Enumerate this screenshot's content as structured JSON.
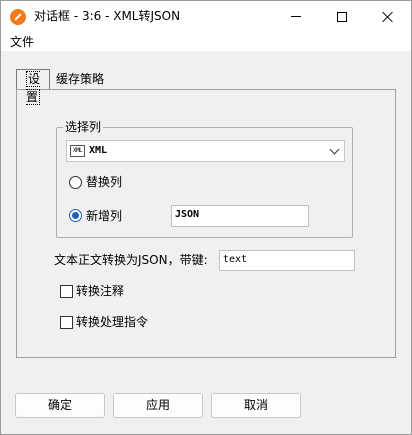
{
  "window": {
    "title": "对话框 - 3:6 - XML转JSON",
    "icon": "app-logo-icon"
  },
  "menu": {
    "file": "文件"
  },
  "tabs": [
    {
      "label": "设置",
      "active": true
    },
    {
      "label": "缓存策略",
      "active": false
    }
  ],
  "group": {
    "title": "选择列",
    "select": {
      "icon_text": "XML",
      "value": "XML"
    },
    "options": {
      "replace_label": "替换列",
      "replace_checked": false,
      "add_label": "新增列",
      "add_checked": true,
      "add_value": "JSON"
    }
  },
  "key": {
    "label": "文本正文转换为JSON，带键:",
    "value": "text"
  },
  "checkboxes": {
    "comment_label": "转换注释",
    "comment_checked": false,
    "pi_label": "转换处理指令",
    "pi_checked": false
  },
  "buttons": {
    "ok": "确定",
    "apply": "应用",
    "cancel": "取消"
  }
}
